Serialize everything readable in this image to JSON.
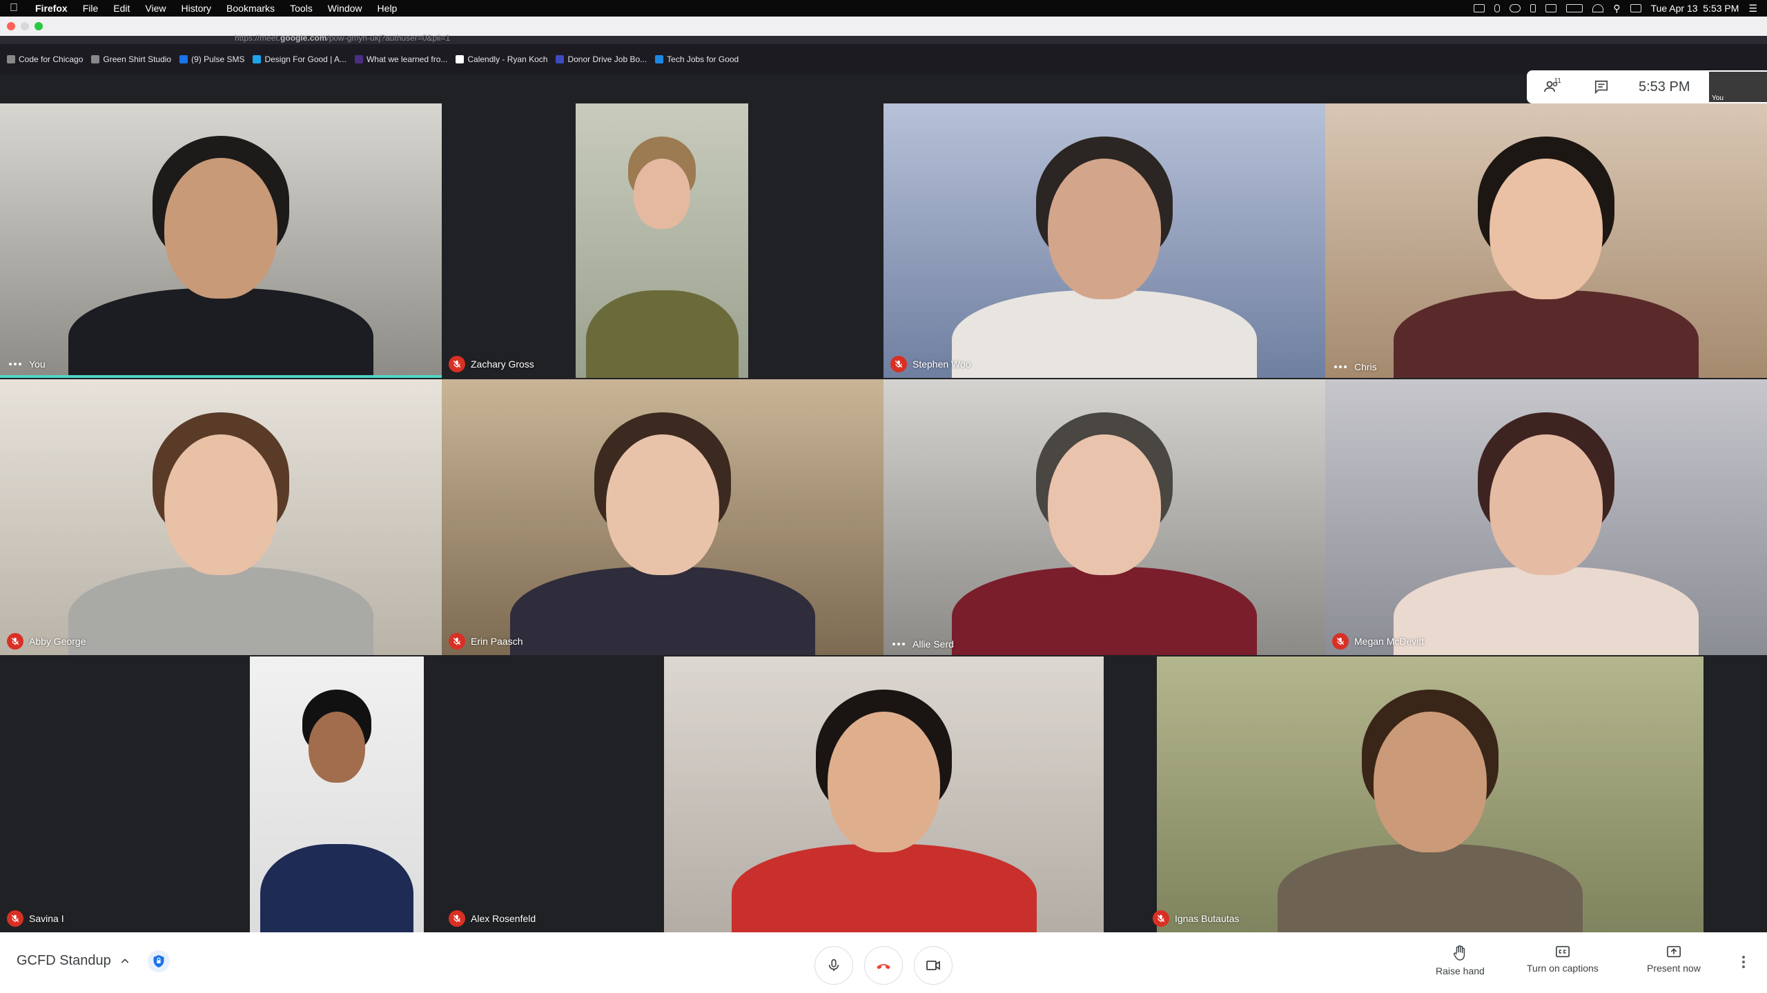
{
  "menubar": {
    "app": "Firefox",
    "items": [
      "File",
      "Edit",
      "View",
      "History",
      "Bookmarks",
      "Tools",
      "Window",
      "Help"
    ],
    "datetime": "Tue Apr 13  5:53 PM"
  },
  "browser": {
    "url_prefix": "https://meet.",
    "url_domain": "google.com",
    "url_rest": "/pow-gmyn-ukj?authuser=0&pli=1"
  },
  "bookmarks": [
    {
      "label": "Code for Chicago",
      "color": "#888888"
    },
    {
      "label": "Green Shirt Studio",
      "color": "#888888"
    },
    {
      "label": "(9) Pulse SMS",
      "color": "#1a73e8"
    },
    {
      "label": "Design For Good | A...",
      "color": "#1ea5e9"
    },
    {
      "label": "What we learned fro...",
      "color": "#4b2e83"
    },
    {
      "label": "Calendly - Ryan Koch",
      "color": "#ffffff"
    },
    {
      "label": "Donor Drive Job Bo...",
      "color": "#3b4cc0"
    },
    {
      "label": "Tech Jobs for Good",
      "color": "#1e88e5"
    }
  ],
  "meet_header": {
    "participants_count": "11",
    "time": "5:53 PM",
    "self_label": "You"
  },
  "participants": [
    {
      "name": "You",
      "status": "active"
    },
    {
      "name": "Zachary Gross",
      "status": "muted"
    },
    {
      "name": "Stephen Woo",
      "status": "muted"
    },
    {
      "name": "Chris",
      "status": "active"
    },
    {
      "name": "Abby George",
      "status": "muted"
    },
    {
      "name": "Erin Paasch",
      "status": "muted"
    },
    {
      "name": "Allie Serd",
      "status": "active"
    },
    {
      "name": "Megan McDevitt",
      "status": "muted"
    },
    {
      "name": "Savina I",
      "status": "muted"
    },
    {
      "name": "Alex Rosenfeld",
      "status": "muted"
    },
    {
      "name": "Ignas Butautas",
      "status": "muted"
    }
  ],
  "bottom": {
    "meeting_title": "GCFD Standup",
    "raise_hand": "Raise hand",
    "captions": "Turn on captions",
    "present": "Present now"
  },
  "colors": {
    "accent_speaking": "#4fd6c7",
    "mute_red": "#d93025",
    "end_call_red": "#ea4335"
  }
}
